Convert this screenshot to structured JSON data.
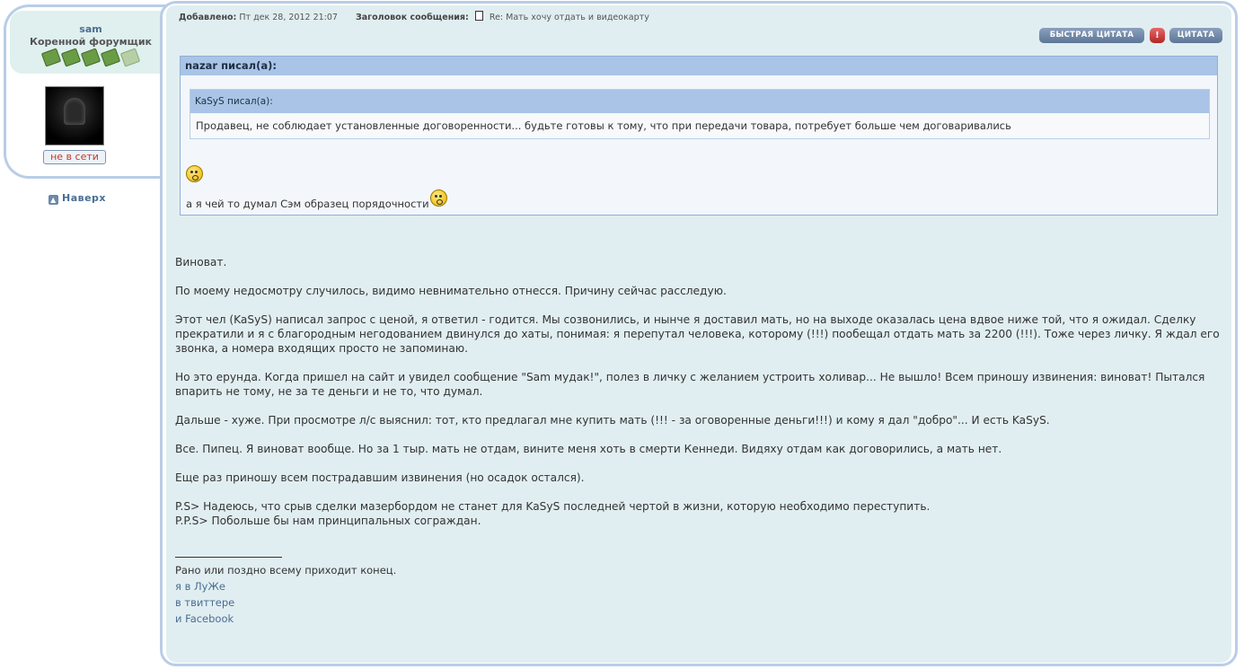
{
  "profile": {
    "username": "sam",
    "rank": "Коренной форумщик",
    "rank_icons_filled": 4,
    "rank_icons_total": 5,
    "status": "не в сети",
    "back_to_top": "Наверх"
  },
  "post_meta": {
    "added_label": "Добавлено:",
    "added_value": "Пт дек 28, 2012 21:07",
    "subject_label": "Заголовок сообщения:",
    "subject_value": "Re: Мать хочу отдать и видеокарту"
  },
  "buttons": {
    "quick_quote": "БЫСТРАЯ ЦИТАТА",
    "report": "!",
    "quote": "ЦИТАТА"
  },
  "quote": {
    "outer_author": "nazar писал(а):",
    "inner_author": "KaSyS писал(а):",
    "inner_text": "Продавец, не соблюдает установленные договоренности... будьте готовы к тому, что при передачи товара, потребует больше чем договаривались",
    "outer_text": "а я чей то думал Сэм образец порядочности"
  },
  "body": {
    "p1": "Виноват.",
    "p2": "По моему недосмотру случилось, видимо невнимательно отнесся. Причину сейчас расследую.",
    "p3": "Этот чел (KaSyS) написал запрос с ценой, я ответил - годится. Мы созвонились, и нынче я доставил мать, но на выходе оказалась цена вдвое ниже той, что я ожидал. Сделку прекратили и я с благородным негодованием двинулся до хаты, понимая: я перепутал человека, которому (!!!) пообещал отдать мать за 2200 (!!!). Тоже через личку. Я ждал его звонка, а номера входящих просто не запоминаю.",
    "p4": "Но это ерунда. Когда пришел на сайт и увидел сообщение \"Sam мудак!\", полез в личку с желанием устроить холивар... Не вышло! Всем приношу извинения: виноват! Пытался впарить не тому, не за те деньги и не то, что думал.",
    "p5": "Дальше - хуже. При просмотре л/с выяснил: тот, кто предлагал мне купить мать (!!! - за оговоренные деньги!!!) и кому я дал \"добро\"... И есть KaSyS.",
    "p6": "Все. Пипец. Я виноват вообще. Но за 1 тыр. мать не отдам, вините меня хоть в смерти Кеннеди. Видяху отдам как договорились, а мать нет.",
    "p7": "Еще раз приношу всем пострадавшим извинения (но осадок остался).",
    "p8a": "P.S> Надеюсь, что срыв сделки мазербордом не станет для KaSyS последней чертой в жизни, которую необходимо переступить.",
    "p8b": "P.P.S> Побольше бы нам принципальных сограждан."
  },
  "signature": {
    "text": "Рано или поздно всему приходит конец.",
    "link1": "я в ЛуЖе",
    "link2": "в твиттере",
    "link3": "и Facebook"
  }
}
